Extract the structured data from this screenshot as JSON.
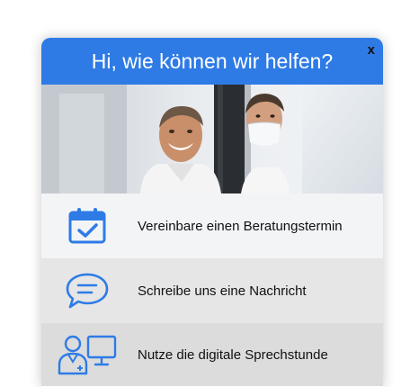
{
  "header": {
    "title": "Hi, wie können wir helfen?",
    "close_label": "x",
    "color": "#2e7be6"
  },
  "hero": {
    "image": "photo-two-dentists-smiling"
  },
  "menu": {
    "items": [
      {
        "label": "Vereinbare einen Beratungstermin",
        "icon": "calendar-check-icon"
      },
      {
        "label": "Schreibe uns eine Nachricht",
        "icon": "chat-bubble-icon"
      },
      {
        "label": "Nutze die digitale Sprechstunde",
        "icon": "doctor-monitor-icon"
      }
    ],
    "icon_color": "#2e7be6"
  }
}
